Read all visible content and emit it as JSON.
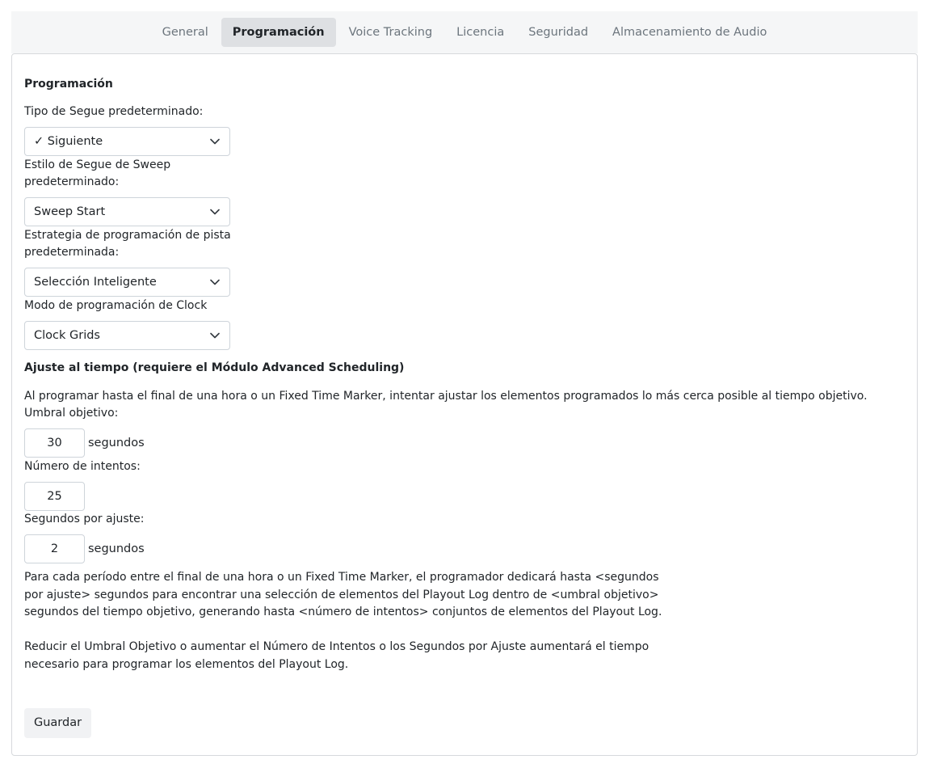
{
  "tabs": [
    {
      "label": "General"
    },
    {
      "label": "Programación",
      "active": true
    },
    {
      "label": "Voice Tracking"
    },
    {
      "label": "Licencia"
    },
    {
      "label": "Seguridad"
    },
    {
      "label": "Almacenamiento de Audio"
    }
  ],
  "programacion": {
    "title": "Programación",
    "segue_type_label": "Tipo de Segue predeterminado:",
    "segue_type_value": "✓ Siguiente",
    "sweep_style_label": "Estilo de Segue de Sweep predeterminado:",
    "sweep_style_value": "Sweep Start",
    "track_strategy_label": "Estrategia de programación de pista predeterminada:",
    "track_strategy_value": "Selección Inteligente",
    "clock_mode_label": "Modo de programación de Clock",
    "clock_mode_value": "Clock Grids"
  },
  "ajuste": {
    "title": "Ajuste al tiempo (requiere el Módulo Advanced Scheduling)",
    "description": "Al programar hasta el final de una hora o un Fixed Time Marker, intentar ajustar los elementos programados lo más cerca posible al tiempo objetivo.",
    "threshold_label": "Umbral objetivo:",
    "threshold_value": "30",
    "threshold_unit": "segundos",
    "attempts_label": "Número de intentos:",
    "attempts_value": "25",
    "seconds_label": "Segundos por ajuste:",
    "seconds_value": "2",
    "seconds_unit": "segundos",
    "explanation": "Para cada período entre el final de una hora o un Fixed Time Marker, el programador dedicará hasta <segundos por ajuste> segundos para encontrar una selección de elementos del Playout Log dentro de <umbral objetivo> segundos del tiempo objetivo, generando hasta <número de intentos> conjuntos de elementos del Playout Log.",
    "warning": "Reducir el Umbral Objetivo o aumentar el Número de Intentos o los Segundos por Ajuste aumentará el tiempo necesario para programar los elementos del Playout Log."
  },
  "save_label": "Guardar",
  "icons": {
    "dropdown": "chevron-down-icon"
  }
}
